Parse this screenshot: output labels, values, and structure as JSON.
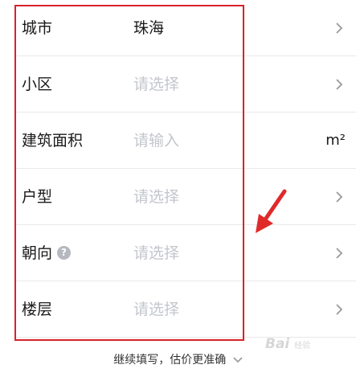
{
  "form": {
    "rows": [
      {
        "label": "城市",
        "value": "珠海"
      },
      {
        "label": "小区",
        "placeholder": "请选择"
      },
      {
        "label": "建筑面积",
        "placeholder": "请输入",
        "unit": "m²"
      },
      {
        "label": "户型",
        "placeholder": "请选择"
      },
      {
        "label": "朝向",
        "placeholder": "请选择"
      },
      {
        "label": "楼层",
        "placeholder": "请选择"
      }
    ]
  },
  "footer": {
    "expand_label": "继续填写，估价更准确"
  },
  "watermark": {
    "text": "Bai",
    "suffix": "经验"
  },
  "icons": {
    "help": "?"
  },
  "colors": {
    "highlight": "#d8222a",
    "placeholder": "#c3c6cc",
    "text": "#1a1a1a"
  }
}
